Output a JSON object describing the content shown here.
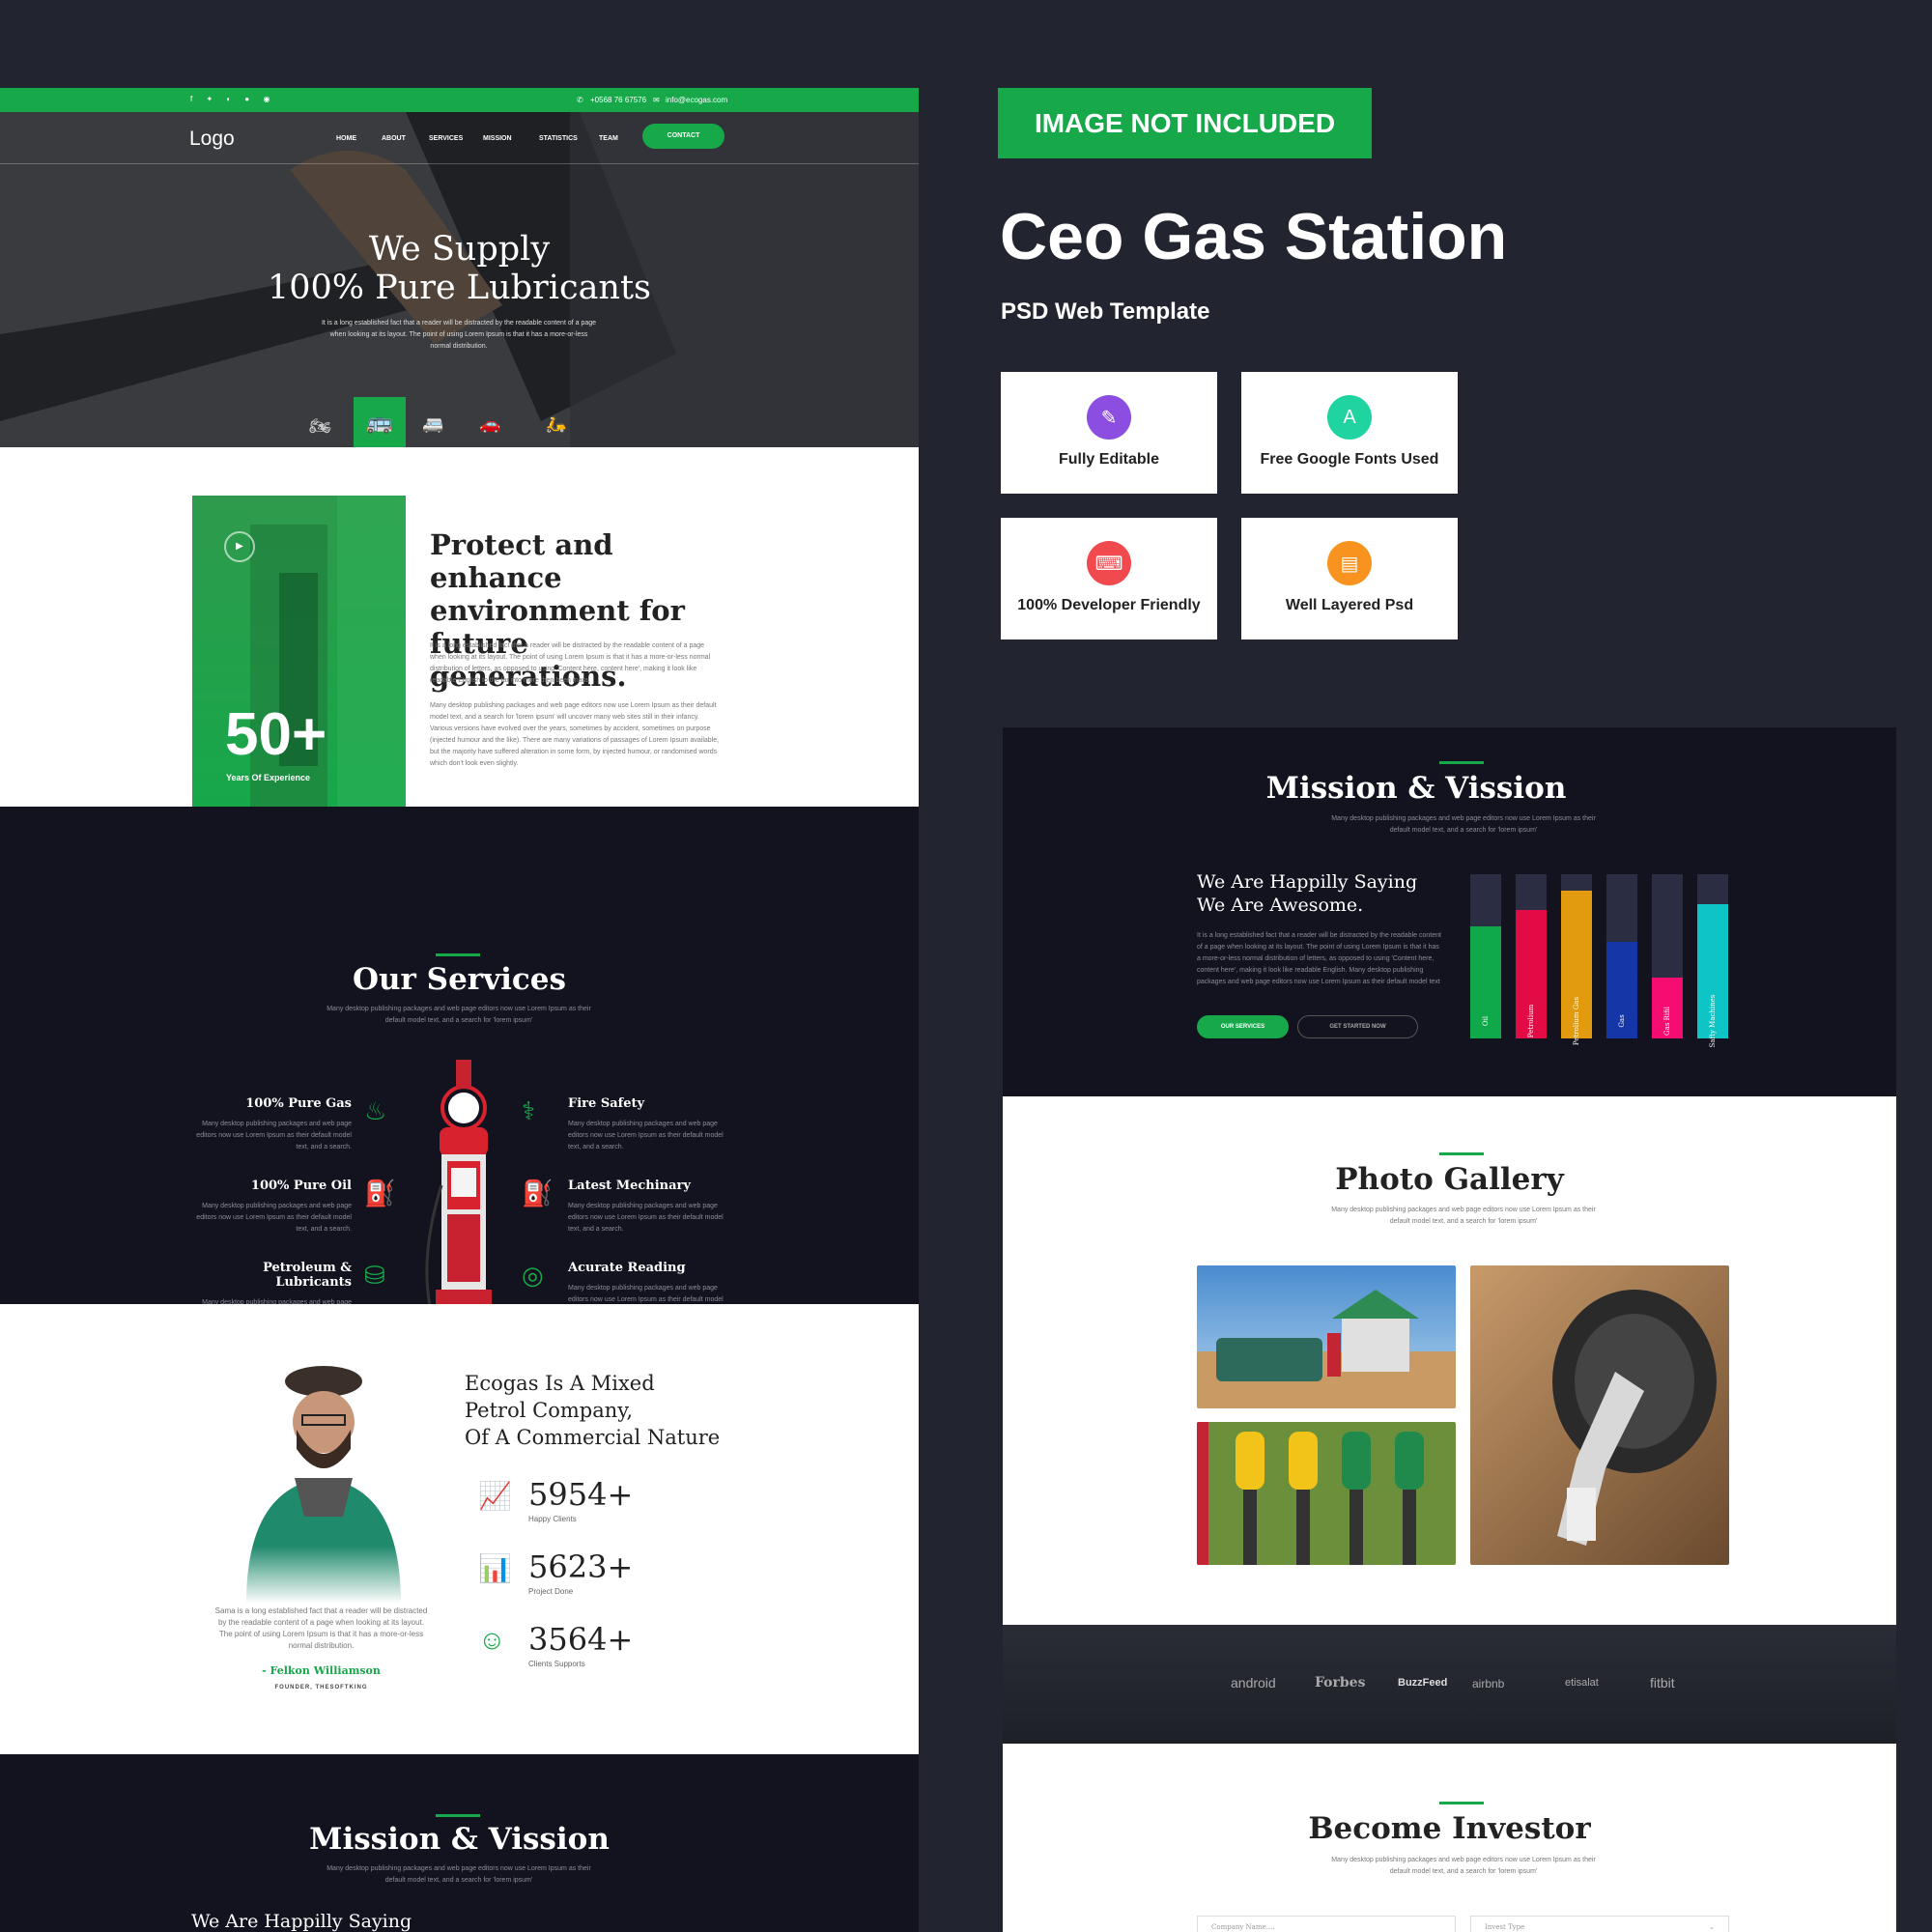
{
  "promo": {
    "badge": "IMAGE NOT INCLUDED",
    "title": "Ceo Gas Station",
    "subtitle": "PSD Web Template",
    "features": [
      {
        "label": "Fully Editable",
        "icon": "edit-icon",
        "color": "#8b4ee0"
      },
      {
        "label": "Free Google Fonts Used",
        "icon": "font-icon",
        "color": "#1fd4a0"
      },
      {
        "label": "100% Developer Friendly",
        "icon": "code-icon",
        "color": "#f04a4f"
      },
      {
        "label": "Well Layered Psd",
        "icon": "psd-icon",
        "color": "#f7931e"
      }
    ]
  },
  "topbar": {
    "phone": "+0568 76 67576",
    "email": "info@ecogas.com"
  },
  "nav": {
    "logo": "Logo",
    "items": [
      "HOME",
      "ABOUT",
      "SERVICES",
      "MISSION",
      "STATISTICS",
      "TEAM"
    ],
    "contact": "CONTACT"
  },
  "hero": {
    "title1": "We Supply",
    "title2": "100% Pure Lubricants",
    "text": "It is a long established fact that a reader will be distracted by the readable content of a page when looking at its layout. The point of using Lorem Ipsum is that it has a more-or-less normal distribution."
  },
  "about": {
    "years": "50+",
    "years_label": "Years Of Experience",
    "title": "Protect and enhance environment for future generations.",
    "p1": "It is a long established fact that a reader will be distracted by the readable content of a page when looking at its layout. The point of using Lorem Ipsum is that it has a more-or-less normal distribution of letters, as opposed to using 'Content here, content here', making it look like readable English to the far into more then been mara.",
    "p2": "Many desktop publishing packages and web page editors now use Lorem Ipsum as their default model text, and a search for 'lorem ipsum' will uncover many web sites still in their infancy. Various versions have evolved over the years, sometimes by accident, sometimes on purpose (injected humour and the like). There are many variations of passages of Lorem Ipsum available, but the majority have suffered alteration in some form, by injected humour, or randomised words which don't look even slightly."
  },
  "services": {
    "title": "Our Services",
    "intro": "Many desktop publishing packages and web page editors now use Lorem Ipsum as their default model text, and a search for 'lorem ipsum'",
    "desc": "Many desktop publishing packages and web page editors now use Lorem Ipsum as their default model text, and a search.",
    "left": [
      "100% Pure Gas",
      "100% Pure Oil",
      "Petroleum & Lubricants"
    ],
    "right": [
      "Fire Safety",
      "Latest Mechinary",
      "Acurate Reading"
    ]
  },
  "company": {
    "title1": "Ecogas Is A Mixed",
    "title2": "Petrol Company,",
    "title3": "Of A Commercial Nature",
    "quote": "Sama is a long established fact that a reader will be distracted by the readable content of a page when looking at its layout. The point of using Lorem Ipsum is that it has a more-or-less normal distribution.",
    "name": "- Felkon Williamson",
    "role": "FOUNDER, THESOFTKING",
    "stats": [
      {
        "n": "5954+",
        "l": "Happy Clients"
      },
      {
        "n": "5623+",
        "l": "Project Done"
      },
      {
        "n": "3564+",
        "l": "Clients Supports"
      }
    ]
  },
  "mission": {
    "title": "Mission & Vission",
    "intro": "Many desktop publishing packages and web page editors now use Lorem Ipsum as their default model text, and a search for 'lorem ipsum'",
    "h1": "We Are Happilly Saying",
    "h2": "We Are Awesome.",
    "text": "It is a long established fact that a reader will be distracted by the readable content of a page when looking at its layout. The point of using Lorem Ipsum is that it has a more-or-less normal distribution of letters, as opposed to using 'Content here, content here', making it look like readable English. Many desktop publishing packages and web page editors now use Lorem Ipsum as their default model text",
    "btn1": "OUR SERVICES",
    "btn2": "GET STARTED NOW",
    "left_title_partial": "We Are Happilly Saying"
  },
  "chart_data": {
    "type": "bar",
    "categories": [
      "Oil",
      "Petrolium",
      "Petrolium Gas",
      "Gas",
      "Gas Rifil",
      "Safty Machines"
    ],
    "values": [
      68,
      78,
      90,
      59,
      37,
      82
    ],
    "ylim": [
      0,
      100
    ],
    "colors": [
      "#0fa84a",
      "#e30b45",
      "#e29a0e",
      "#1436a6",
      "#f60d72",
      "#0fc4c4"
    ]
  },
  "gallery": {
    "title": "Photo Gallery",
    "intro": "Many desktop publishing packages and web page editors now use Lorem Ipsum as their default model text, and a search for 'lorem ipsum'"
  },
  "brands": [
    "android",
    "Forbes",
    "BuzzFeed",
    "airbnb",
    "etisalat",
    "fitbit"
  ],
  "investor": {
    "title": "Become Investor",
    "intro": "Many desktop publishing packages and web page editors now use Lorem Ipsum as their default model text, and a search for 'lorem ipsum'",
    "company_ph": "Company Name....",
    "type_ph": "Invest Type"
  }
}
